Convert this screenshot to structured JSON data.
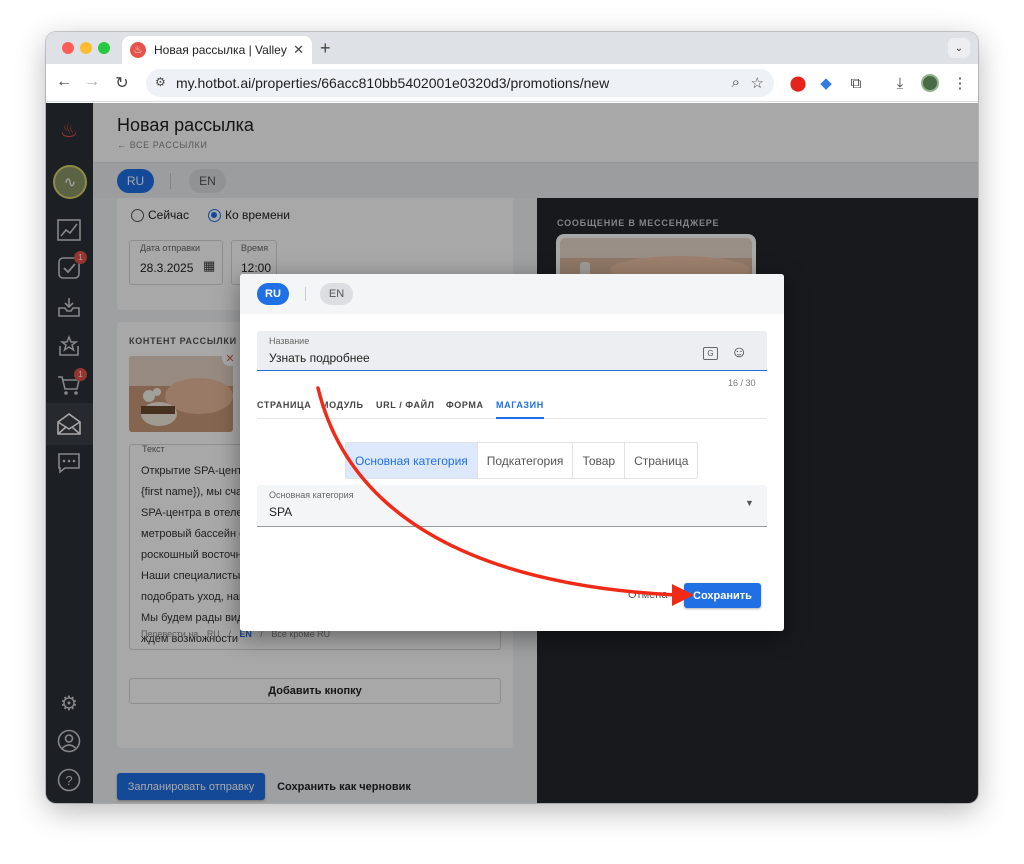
{
  "browser": {
    "tab_title": "Новая рассылка | Valley Hotel",
    "tab_favicon": "flame-icon",
    "url": "my.hotbot.ai/properties/66acc810bb5402001e0320d3/promotions/new"
  },
  "header": {
    "title": "Новая рассылка",
    "back_label": "← ВСЕ РАССЫЛКИ"
  },
  "languages": {
    "active": "RU",
    "other": "EN"
  },
  "sidebar": {
    "items": [
      {
        "icon": "flame-logo-icon"
      },
      {
        "icon": "property-avatar-icon"
      },
      {
        "icon": "analytics-icon"
      },
      {
        "icon": "tasks-icon",
        "badge": "1"
      },
      {
        "icon": "inbox-icon"
      },
      {
        "icon": "rating-icon"
      },
      {
        "icon": "cart-icon",
        "badge": "1"
      },
      {
        "icon": "promotions-icon"
      },
      {
        "icon": "chat-icon"
      },
      {
        "icon": "settings-icon"
      },
      {
        "icon": "profile-icon"
      },
      {
        "icon": "help-icon"
      }
    ]
  },
  "schedule": {
    "option_now": "Сейчас",
    "option_time": "Ко времени",
    "date_label": "Дата отправки",
    "date_value": "28.3.2025",
    "time_label": "Время",
    "time_value": "12:00"
  },
  "content": {
    "section_title": "КОНТЕНТ РАССЫЛКИ",
    "text_label": "Текст",
    "text_lines": [
      "Открытие SPA-цент",
      "{first name}), мы сча",
      "SPA-центра в отеле",
      "метровый бассейн с",
      "роскошный восточн",
      "Наши специалисты",
      "подобрать уход, наи",
      "Мы будем рады вид",
      "ждем возможности"
    ],
    "translate_label": "Перевести на",
    "translate_ru": "RU",
    "translate_en": "EN",
    "translate_all": "Все кроме RU",
    "add_button": "Добавить кнопку"
  },
  "actions": {
    "schedule_button": "Запланировать отправку",
    "draft_button": "Сохранить как черновик"
  },
  "preview": {
    "title": "СООБЩЕНИЕ В МЕССЕНДЖЕРЕ"
  },
  "modal": {
    "lang_active": "RU",
    "lang_other": "EN",
    "name_label": "Название",
    "name_value": "Узнать подробнее",
    "char_count": "16 / 30",
    "tabs": [
      "СТРАНИЦА",
      "МОДУЛЬ",
      "URL / ФАЙЛ",
      "ФОРМА",
      "МАГАЗИН"
    ],
    "active_tab": "МАГАЗИН",
    "segments": [
      "Основная категория",
      "Подкатегория",
      "Товар",
      "Страница"
    ],
    "active_segment": "Основная категория",
    "select_label": "Основная категория",
    "select_value": "SPA",
    "cancel_button": "Отмена",
    "save_button": "Сохранить"
  },
  "colors": {
    "accent": "#1f6fe5",
    "sidebar_bg": "#2b2f36",
    "badge": "#e5534b",
    "annotation_arrow": "#f02a17"
  }
}
